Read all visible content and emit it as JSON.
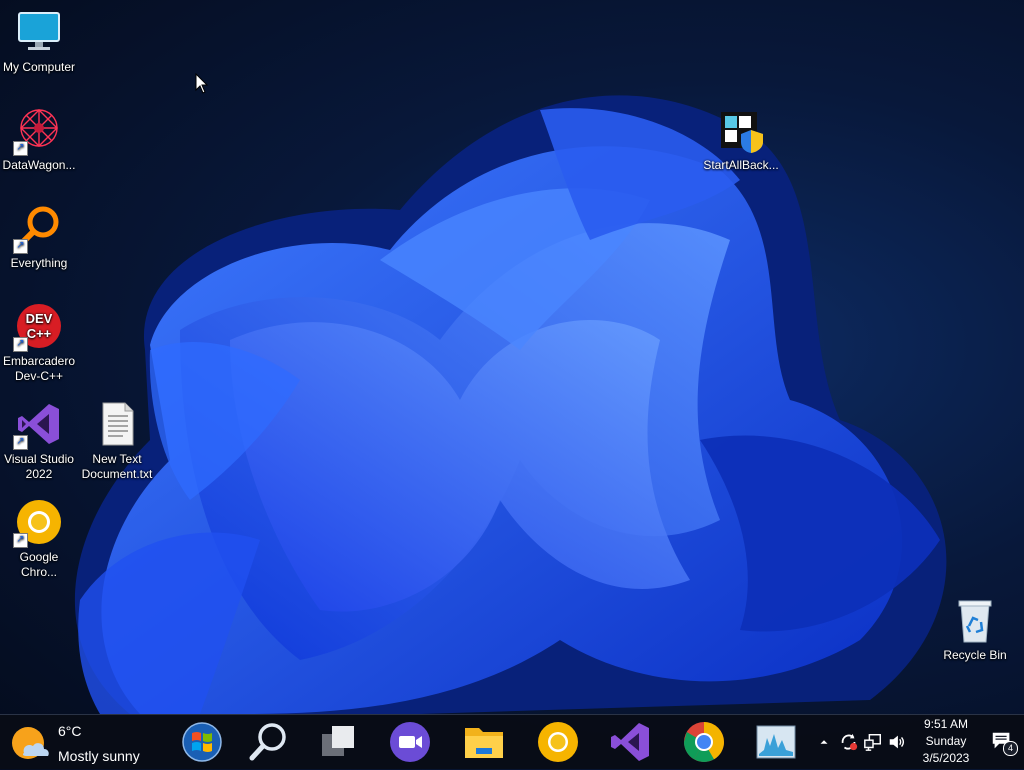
{
  "desktop": {
    "icons": [
      {
        "label": "My Computer",
        "icon": "monitor-icon"
      },
      {
        "label": "DataWagon...",
        "icon": "datawagon-icon"
      },
      {
        "label": "Everything",
        "icon": "magnifier-icon"
      },
      {
        "label": "Embarcadero Dev-C++",
        "icon": "devcpp-icon"
      },
      {
        "label": "Visual Studio 2022",
        "icon": "visual-studio-icon"
      },
      {
        "label": "New Text Document.txt",
        "icon": "text-file-icon"
      },
      {
        "label": "Google Chro...",
        "icon": "chrome-canary-icon"
      },
      {
        "label": "StartAllBack...",
        "icon": "startallback-icon"
      },
      {
        "label": "Recycle Bin",
        "icon": "recycle-bin-icon"
      }
    ]
  },
  "taskbar": {
    "weather": {
      "temperature": "6°C",
      "condition": "Mostly sunny"
    },
    "apps": [
      {
        "name": "start-button",
        "icon": "windows-logo-icon"
      },
      {
        "name": "search",
        "icon": "search-icon"
      },
      {
        "name": "task-view",
        "icon": "task-view-icon"
      },
      {
        "name": "meet",
        "icon": "video-camera-icon"
      },
      {
        "name": "file-explorer",
        "icon": "folder-icon"
      },
      {
        "name": "chrome-canary",
        "icon": "chrome-canary-icon"
      },
      {
        "name": "visual-studio",
        "icon": "visual-studio-icon"
      },
      {
        "name": "chrome",
        "icon": "chrome-icon"
      },
      {
        "name": "resource-monitor",
        "icon": "performance-monitor-icon"
      }
    ],
    "tray": {
      "icons": [
        "chevron-up-icon",
        "sync-icon",
        "network-icon",
        "volume-icon"
      ]
    },
    "clock": {
      "time": "9:51 AM",
      "day": "Sunday",
      "date": "3/5/2023"
    },
    "notifications": {
      "count": "4"
    }
  },
  "colors": {
    "accent_blue": "#1e5bff",
    "taskbar_bg": "#080c16",
    "wallpaper_dark": "#040b1c"
  }
}
